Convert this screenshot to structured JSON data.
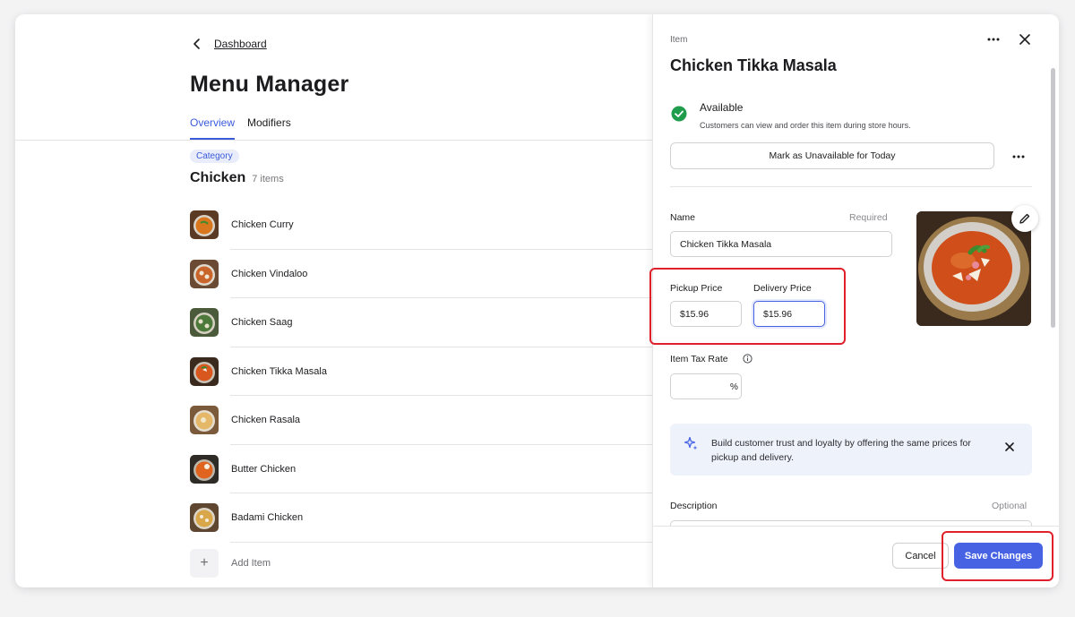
{
  "left": {
    "back_label": "Dashboard",
    "page_title": "Menu Manager",
    "tabs": [
      {
        "label": "Overview",
        "active": true
      },
      {
        "label": "Modifiers",
        "active": false
      }
    ],
    "category_badge": "Category",
    "category_name": "Chicken",
    "category_count": "7 items",
    "items": [
      {
        "name": "Chicken Curry"
      },
      {
        "name": "Chicken Vindaloo"
      },
      {
        "name": "Chicken Saag"
      },
      {
        "name": "Chicken Tikka Masala"
      },
      {
        "name": "Chicken Rasala"
      },
      {
        "name": "Butter Chicken"
      },
      {
        "name": "Badami Chicken"
      }
    ],
    "add_item_label": "Add Item"
  },
  "panel": {
    "eyebrow": "Item",
    "title": "Chicken Tikka Masala",
    "availability": {
      "title": "Available",
      "description": "Customers can view and order this item during store hours."
    },
    "unavailable_button": "Mark as Unavailable for Today",
    "name_label": "Name",
    "name_required": "Required",
    "name_value": "Chicken Tikka Masala",
    "pickup_label": "Pickup Price",
    "pickup_value": "$15.96",
    "delivery_label": "Delivery Price",
    "delivery_value": "$15.96",
    "tax_label": "Item Tax Rate",
    "tax_value": "",
    "tax_unit": "%",
    "tip_text": "Build customer trust and loyalty by offering the same prices for pickup and delivery.",
    "description_label": "Description",
    "description_optional": "Optional",
    "cancel_button": "Cancel",
    "save_button": "Save Changes"
  },
  "colors": {
    "accent": "#4763e4",
    "available_green": "#1f9d4c",
    "highlight_red": "#e0202a"
  },
  "icons": {
    "back": "chevron-left-icon",
    "more": "more-horizontal-icon",
    "close": "close-icon",
    "available": "check-circle-icon",
    "edit": "pencil-icon",
    "info": "info-icon",
    "tip": "sparkle-icon",
    "add": "plus-icon"
  }
}
